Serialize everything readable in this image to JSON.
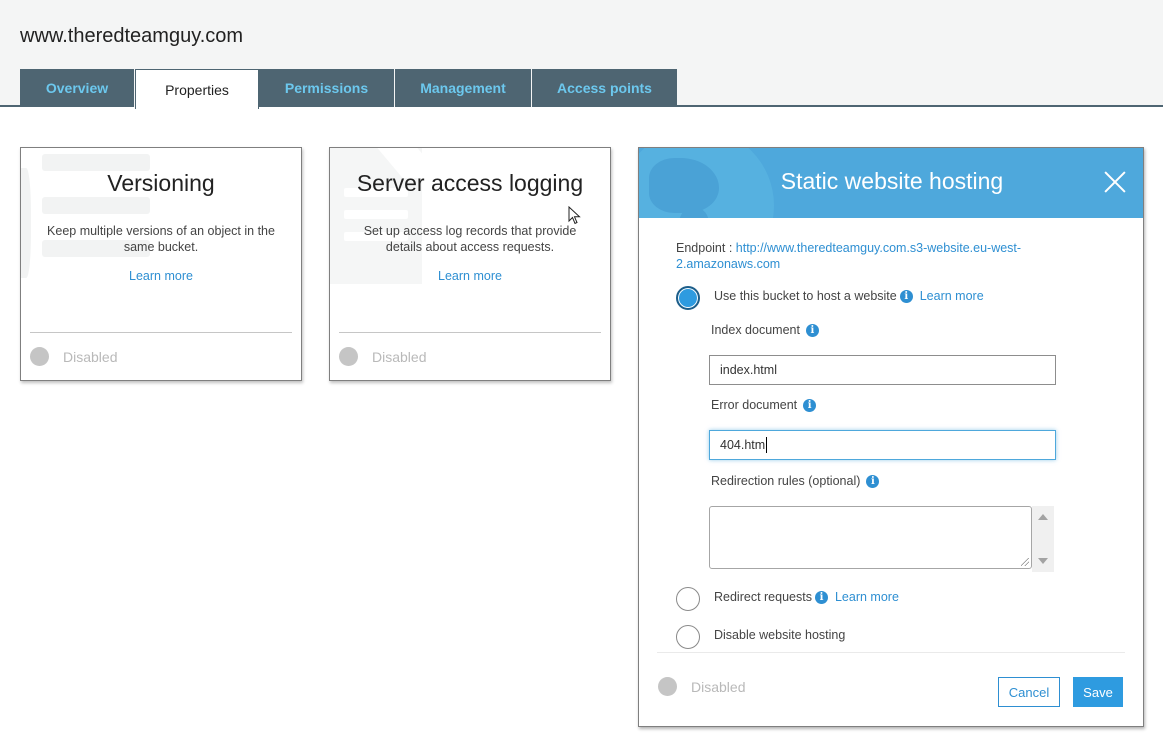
{
  "bucket": {
    "name": "www.theredteamguy.com"
  },
  "tabs": [
    {
      "label": "Overview",
      "active": false
    },
    {
      "label": "Properties",
      "active": true
    },
    {
      "label": "Permissions",
      "active": false
    },
    {
      "label": "Management",
      "active": false
    },
    {
      "label": "Access points",
      "active": false
    }
  ],
  "cards": [
    {
      "title": "Versioning",
      "description": "Keep multiple versions of an object in the same bucket.",
      "learn_more": "Learn more",
      "status": "Disabled"
    },
    {
      "title": "Server access logging",
      "description": "Set up access log records that provide details about access requests.",
      "learn_more": "Learn more",
      "status": "Disabled"
    }
  ],
  "panel": {
    "title": "Static website hosting",
    "endpoint_label": "Endpoint : ",
    "endpoint_url": "http://www.theredteamguy.com.s3-website.eu-west-2.amazonaws.com",
    "options": [
      {
        "label": "Use this bucket to host a website",
        "learn_more": "Learn more",
        "selected": true
      },
      {
        "label": "Redirect requests",
        "learn_more": "Learn more",
        "selected": false
      },
      {
        "label": "Disable website hosting",
        "selected": false
      }
    ],
    "index_document": {
      "label": "Index document",
      "value": "index.html"
    },
    "error_document": {
      "label": "Error document",
      "value": "404.htm"
    },
    "redirection_rules": {
      "label": "Redirection rules (optional)",
      "value": ""
    },
    "status": "Disabled",
    "cancel_label": "Cancel",
    "save_label": "Save",
    "info_glyph": "i"
  },
  "colors": {
    "tab_bg": "#4e6572",
    "tab_text": "#6cc8ee",
    "accent": "#2e9be0",
    "link": "#2e8fd2",
    "header_blue": "#4ea8dc"
  }
}
